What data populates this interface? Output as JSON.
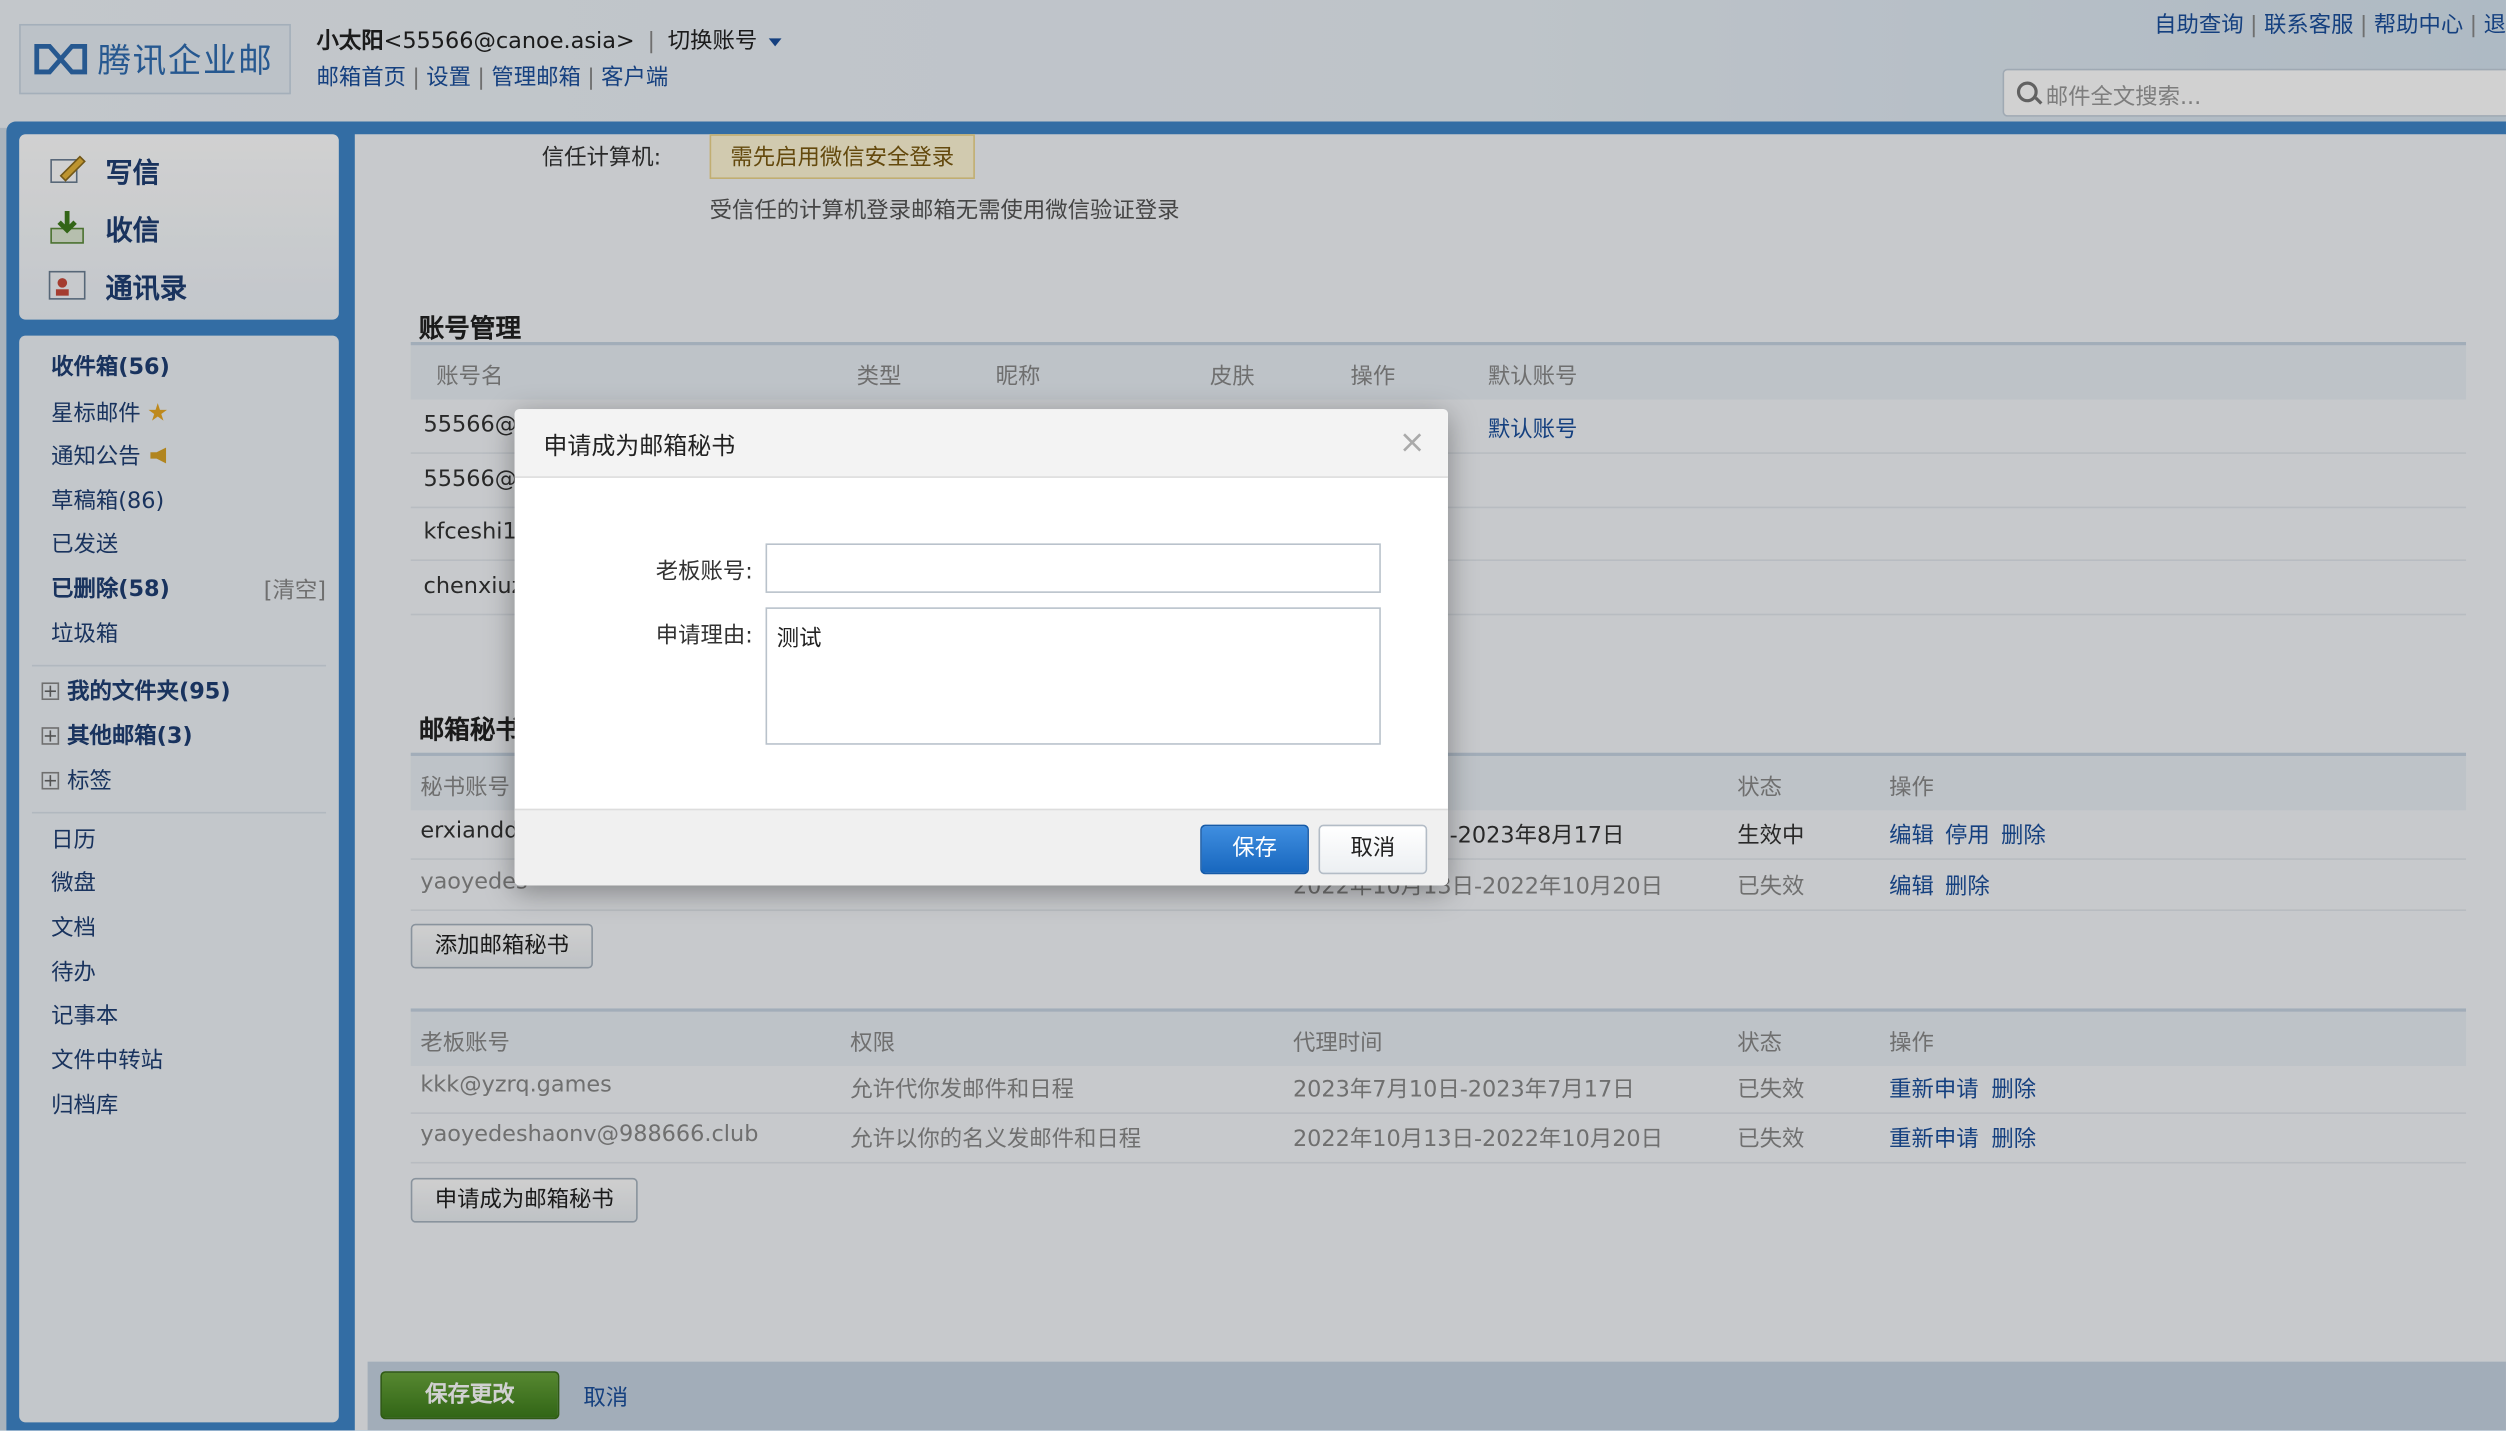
{
  "header": {
    "logo_text": "腾讯企业邮",
    "user_name": "小太阳",
    "user_email": "<55566@canoe.asia>",
    "switch_account": "切换账号",
    "nav": [
      "邮箱首页",
      "设置",
      "管理邮箱",
      "客户端"
    ],
    "top_links": [
      "自助查询",
      "联系客服",
      "帮助中心",
      "退"
    ],
    "search_placeholder": "邮件全文搜索..."
  },
  "sidebar": {
    "quick": [
      "写信",
      "收信",
      "通讯录"
    ],
    "folders": {
      "inbox": "收件箱(56)",
      "starred": "星标邮件",
      "notice": "通知公告",
      "drafts": "草稿箱(86)",
      "sent": "已发送",
      "deleted": "已删除(58)",
      "clear": "[清空]",
      "junk": "垃圾箱",
      "my_folders": "我的文件夹(95)",
      "other_mailboxes": "其他邮箱(3)",
      "tags": "标签"
    },
    "apps": [
      "日历",
      "微盘",
      "文档",
      "待办",
      "记事本",
      "文件中转站",
      "归档库"
    ]
  },
  "trust": {
    "label": "信任计算机:",
    "badge": "需先启用微信安全登录",
    "note": "受信任的计算机登录邮箱无需使用微信验证登录"
  },
  "account_mgmt": {
    "title": "账号管理",
    "headers": [
      "账号名",
      "类型",
      "昵称",
      "皮肤",
      "操作",
      "默认账号"
    ],
    "rows": [
      "55566@",
      "55566@",
      "kfceshi12",
      "chenxiuz"
    ],
    "default_label": "默认账号"
  },
  "secretary": {
    "title": "邮箱秘书",
    "headers": [
      "秘书账号",
      "状态",
      "操作"
    ],
    "rows": [
      {
        "account": "erxiandd",
        "time": "-2023年8月17日",
        "status": "生效中",
        "actions": [
          "编辑",
          "停用",
          "删除"
        ]
      },
      {
        "account": "yaoyedes",
        "time": "2022年10月13日-2022年10月20日",
        "status": "已失效",
        "actions": [
          "编辑",
          "删除"
        ]
      }
    ],
    "add_button": "添加邮箱秘书"
  },
  "boss": {
    "headers": [
      "老板账号",
      "权限",
      "代理时间",
      "状态",
      "操作"
    ],
    "rows": [
      {
        "account": "kkk@yzrq.games",
        "perm": "允许代你发邮件和日程",
        "time": "2023年7月10日-2023年7月17日",
        "status": "已失效",
        "actions": [
          "重新申请",
          "删除"
        ]
      },
      {
        "account": "yaoyedeshaonv@988666.club",
        "perm": "允许以你的名义发邮件和日程",
        "time": "2022年10月13日-2022年10月20日",
        "status": "已失效",
        "actions": [
          "重新申请",
          "删除"
        ]
      }
    ],
    "apply_button": "申请成为邮箱秘书"
  },
  "footer": {
    "save": "保存更改",
    "cancel": "取消"
  },
  "dialog": {
    "title": "申请成为邮箱秘书",
    "boss_label": "老板账号:",
    "boss_value": "",
    "reason_label": "申请理由:",
    "reason_value": "测试",
    "save": "保存",
    "cancel": "取消"
  }
}
